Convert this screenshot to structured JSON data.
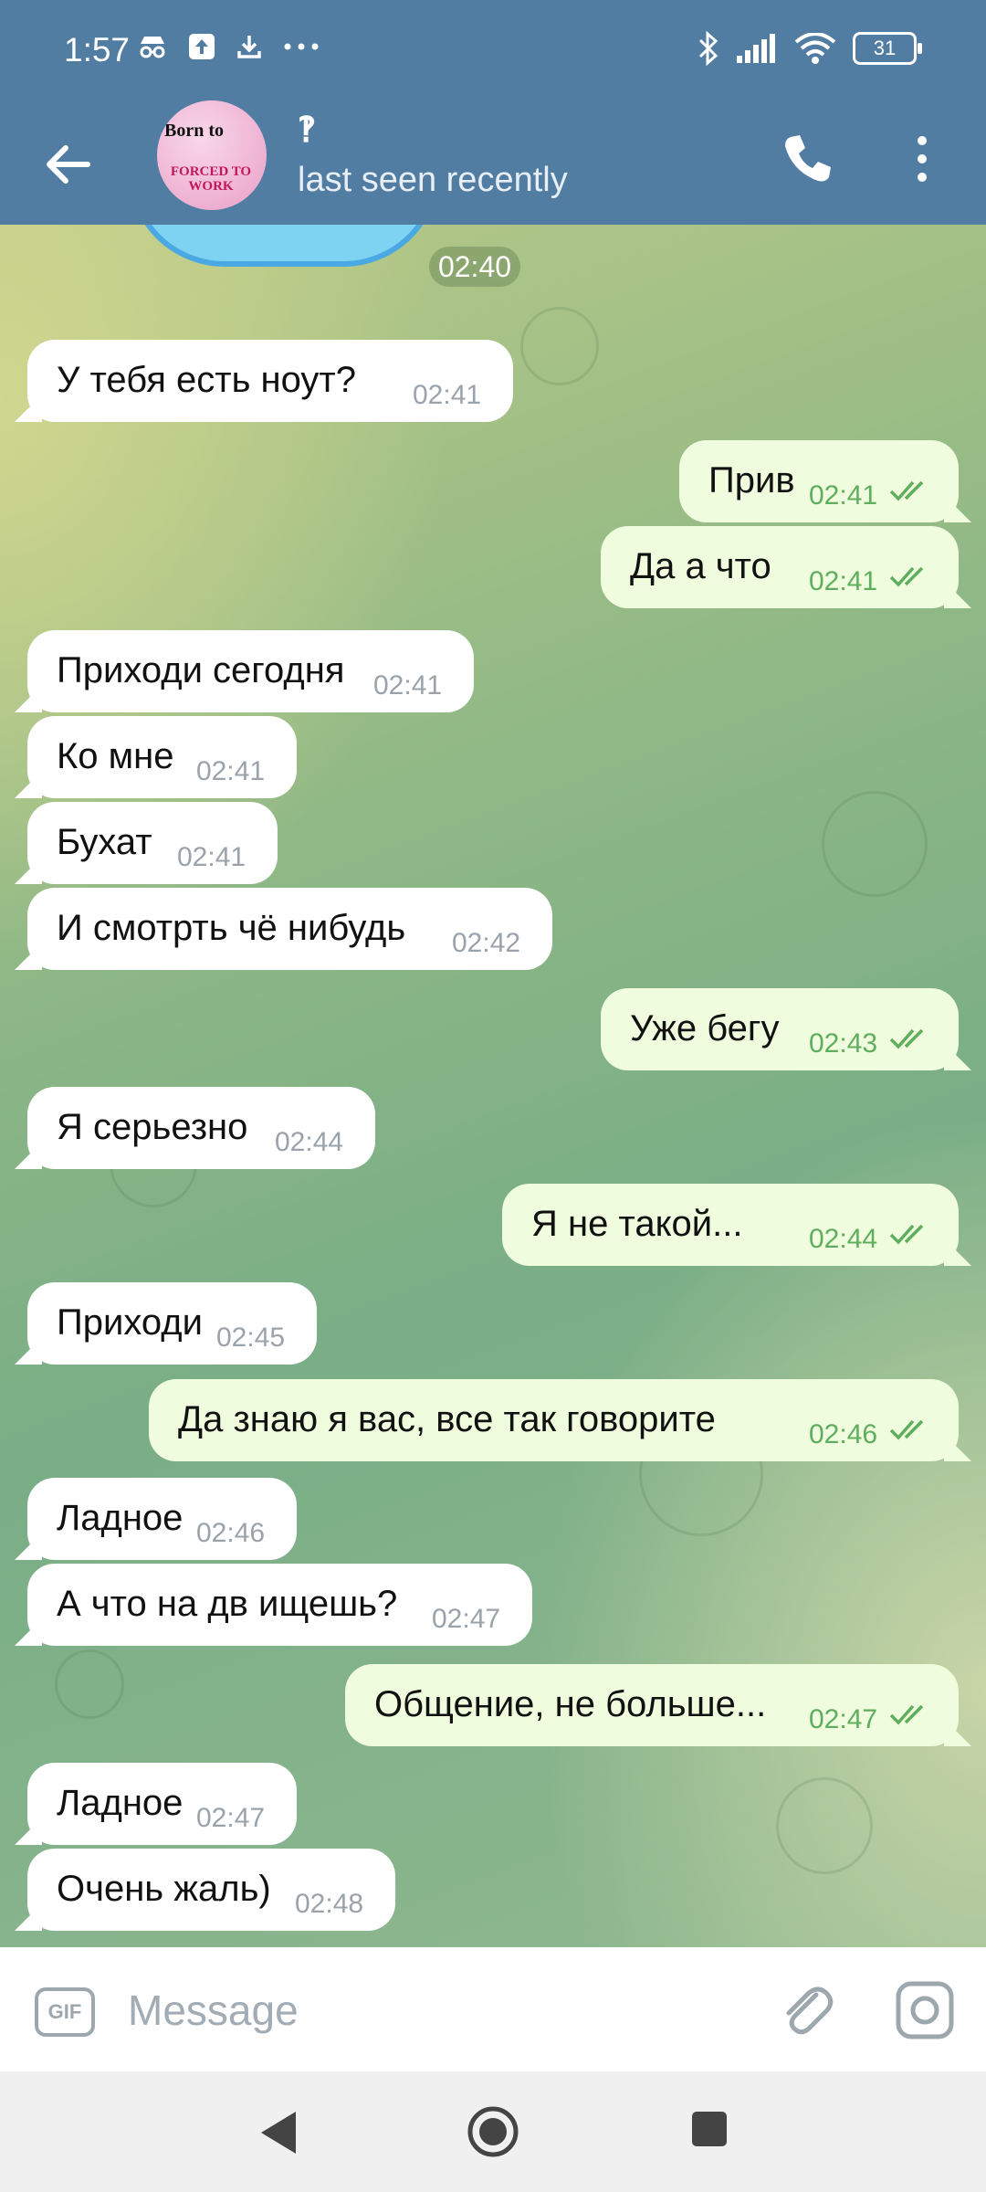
{
  "status_bar": {
    "time": "1:57",
    "left_icons": [
      "incognito-icon",
      "upload-icon",
      "download-icon",
      "more-dots-icon"
    ],
    "right_icons": [
      "bluetooth-icon",
      "signal-icon",
      "wifi-icon"
    ],
    "battery": "31"
  },
  "header": {
    "chat_name": "‽",
    "status": "last seen recently",
    "avatar_text_top": "Born to",
    "avatar_text_bottom": "FORCED TO WORK"
  },
  "chat": {
    "date_time": "02:40",
    "messages": [
      {
        "dir": "in",
        "text": "У тебя есть ноут?",
        "time": "02:41"
      },
      {
        "dir": "out",
        "text": "Прив",
        "time": "02:41"
      },
      {
        "dir": "out",
        "text": "Да а что",
        "time": "02:41"
      },
      {
        "dir": "in",
        "text": "Приходи сегодня",
        "time": "02:41"
      },
      {
        "dir": "in",
        "text": "Ко мне",
        "time": "02:41"
      },
      {
        "dir": "in",
        "text": "Бухат",
        "time": "02:41"
      },
      {
        "dir": "in",
        "text": "И смотрть чё нибудь",
        "time": "02:42"
      },
      {
        "dir": "out",
        "text": "Уже бегу",
        "time": "02:43"
      },
      {
        "dir": "in",
        "text": "Я серьезно",
        "time": "02:44"
      },
      {
        "dir": "out",
        "text": "Я не такой...",
        "time": "02:44"
      },
      {
        "dir": "in",
        "text": "Приходи",
        "time": "02:45"
      },
      {
        "dir": "out",
        "text": "Да знаю я вас, все так говорите",
        "time": "02:46"
      },
      {
        "dir": "in",
        "text": "Ладное",
        "time": "02:46"
      },
      {
        "dir": "in",
        "text": "А что на дв ищешь?",
        "time": "02:47"
      },
      {
        "dir": "out",
        "text": "Общение, не больше...",
        "time": "02:47"
      },
      {
        "dir": "in",
        "text": "Ладное",
        "time": "02:47"
      },
      {
        "dir": "in",
        "text": "Очень жаль)",
        "time": "02:48"
      }
    ]
  },
  "input": {
    "gif_label": "GIF",
    "placeholder": "Message"
  },
  "colors": {
    "header": "#527da3",
    "incoming_bubble": "#ffffff",
    "outgoing_bubble": "#effdde",
    "outgoing_time": "#5fae5e"
  }
}
